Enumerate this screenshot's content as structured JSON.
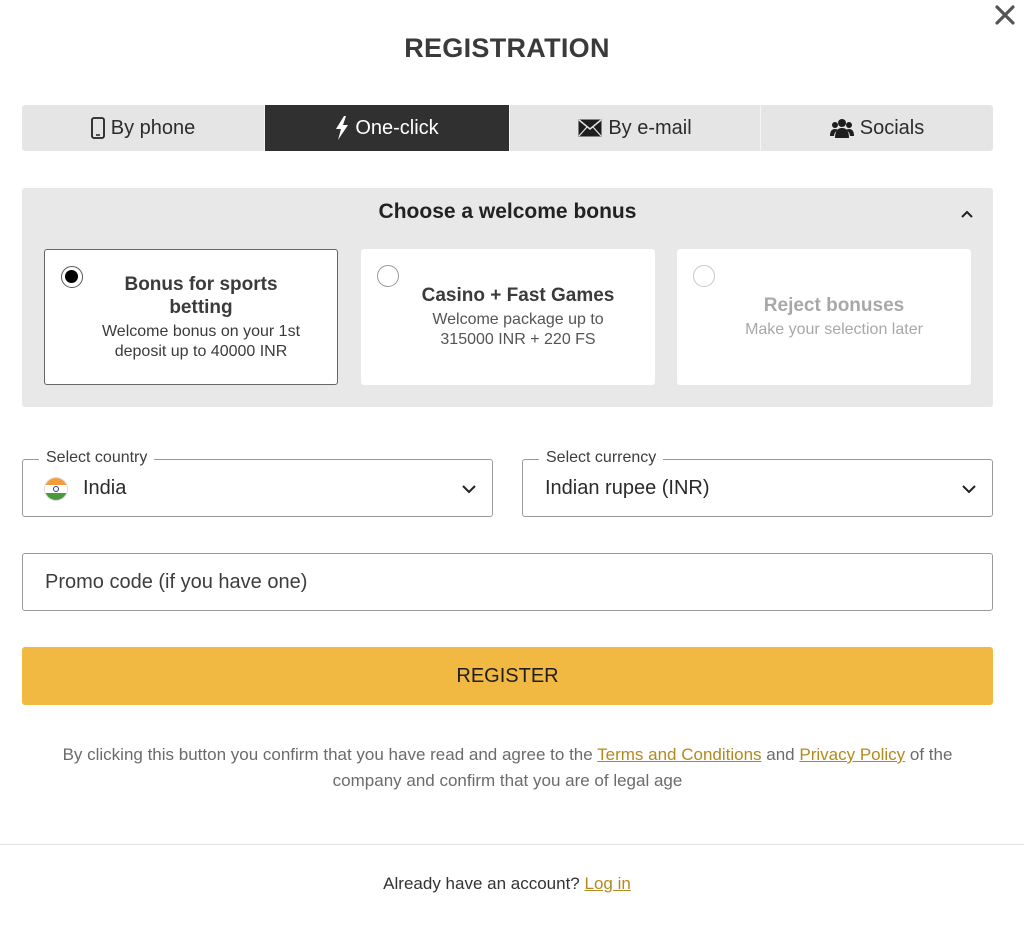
{
  "dialog": {
    "title": "REGISTRATION",
    "close_icon": "close-icon"
  },
  "tabs": [
    {
      "label": "By phone",
      "icon": "phone-icon",
      "active": false
    },
    {
      "label": "One-click",
      "icon": "lightning-icon",
      "active": true
    },
    {
      "label": "By e-mail",
      "icon": "envelope-icon",
      "active": false
    },
    {
      "label": "Socials",
      "icon": "users-icon",
      "active": false
    }
  ],
  "bonus": {
    "title": "Choose a welcome bonus",
    "collapse_icon": "chevron-up-icon",
    "options": [
      {
        "title": "Bonus for sports betting",
        "description": "Welcome bonus on your 1st deposit up to 40000 INR",
        "selected": true,
        "disabled": false
      },
      {
        "title": "Casino + Fast Games",
        "description": "Welcome package up to 315000 INR + 220 FS",
        "selected": false,
        "disabled": false
      },
      {
        "title": "Reject bonuses",
        "description": "Make your selection later",
        "selected": false,
        "disabled": true
      }
    ]
  },
  "form": {
    "country": {
      "label": "Select country",
      "value": "India",
      "flag_icon": "india-flag-icon"
    },
    "currency": {
      "label": "Select currency",
      "value": "Indian rupee (INR)"
    },
    "promo": {
      "placeholder": "Promo code (if you have one)",
      "value": ""
    },
    "register_label": "REGISTER"
  },
  "legal": {
    "prefix": "By clicking this button you confirm that you have read and agree to the ",
    "terms_link": "Terms and Conditions",
    "middle": " and ",
    "privacy_link": "Privacy Policy",
    "suffix": " of the company and confirm that you are of legal age"
  },
  "footer": {
    "question": "Already have an account? ",
    "login_link": "Log in"
  },
  "colors": {
    "accent": "#f2b942",
    "link": "#b38a1e",
    "active_tab": "#303030"
  }
}
